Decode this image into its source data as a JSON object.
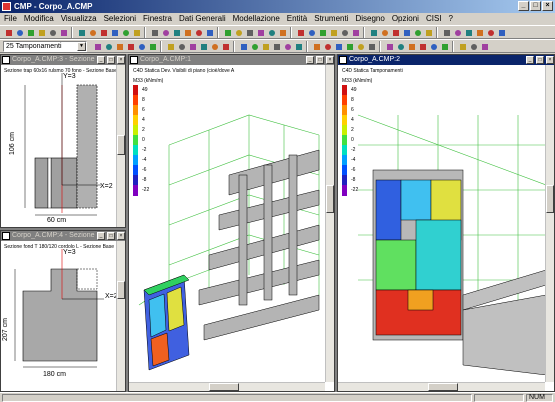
{
  "app": {
    "title": "CMP - Corpo_A.CMP",
    "window_buttons": [
      "_",
      "□",
      "×"
    ]
  },
  "menu": [
    "File",
    "Modifica",
    "Visualizza",
    "Selezioni",
    "Finestra",
    "Dati Generali",
    "Modellazione",
    "Entità",
    "Strumenti",
    "Disegno",
    "Opzioni",
    "CISI",
    "?"
  ],
  "toolbar": {
    "combo_value": "25 Tamponamenti",
    "icons": [
      "open-icon",
      "save-icon",
      "print-icon",
      "undo-icon",
      "zoom-in-icon",
      "zoom-out-icon",
      "pan-icon",
      "rotate-icon",
      "select-icon",
      "line-icon",
      "node-icon",
      "beam-icon",
      "pillar-icon",
      "slab-icon",
      "mesh-icon",
      "load-icon",
      "constraint-icon",
      "solve-icon",
      "results-icon",
      "diagram-icon",
      "settings-icon",
      "help-icon"
    ]
  },
  "windows": {
    "section1": {
      "title": "Corpo_A.CMP:3 - Sezione",
      "subtitle": "Sezione trap 60x16 rulsmo 70 fono - Sezione Base",
      "dim_vertical": "106 cm",
      "dim_horizontal": "60 cm",
      "axis_y": "Y=3",
      "axis_x": "X=2"
    },
    "section2": {
      "title": "Corpo_A.CMP:4 - Sezione",
      "subtitle": "Sezione fond T 180/120 cordolo L - Sezione Base",
      "dim_vertical": "207 cm",
      "dim_horizontal": "180 cm",
      "axis_y": "Y=3",
      "axis_x": "X=2"
    },
    "model1": {
      "title": "Corpo_A.CMP:1",
      "subtitle": "C4D Statica Dev. Visibili di piano (cioè/dove A",
      "legend_title": "M33 (kNm/m)",
      "legend_values": [
        "49",
        "8",
        "6",
        "4",
        "2",
        "0",
        "-2",
        "-4",
        "-6",
        "-8",
        "-22"
      ],
      "legend_colors": [
        "#d01010",
        "#ff4000",
        "#ff9000",
        "#ffd000",
        "#c8f000",
        "#40e040",
        "#00e0c0",
        "#00a0ff",
        "#0050ff",
        "#2020c0",
        "#8000c0"
      ]
    },
    "model2": {
      "title": "Corpo_A.CMP:2",
      "subtitle": "C4D Statica Tamponamenti",
      "legend_title": "M33 (kNm/m)",
      "legend_values": [
        "49",
        "8",
        "6",
        "4",
        "2",
        "0",
        "-2",
        "-4",
        "-6",
        "-8",
        "-22"
      ],
      "legend_colors": [
        "#d01010",
        "#ff4000",
        "#ff9000",
        "#ffd000",
        "#c8f000",
        "#40e040",
        "#00e0c0",
        "#00a0ff",
        "#0050ff",
        "#2020c0",
        "#8000c0"
      ]
    }
  },
  "status": {
    "indicator": "NUM"
  }
}
